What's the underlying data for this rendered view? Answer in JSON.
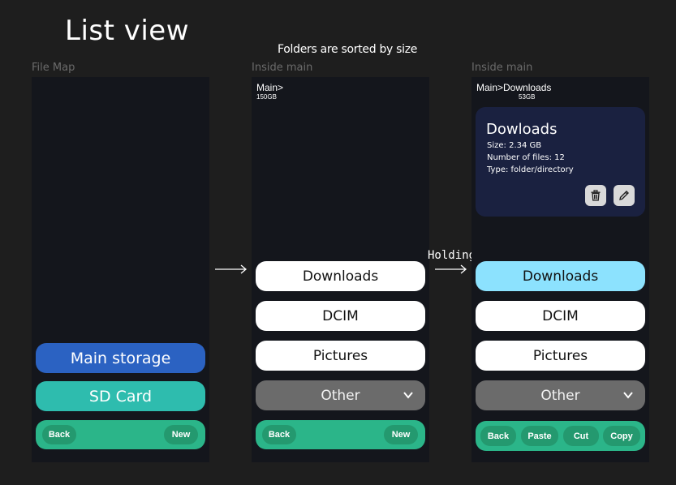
{
  "heading": {
    "title": "List view",
    "subtitle": "Folders are sorted by size"
  },
  "frames": [
    {
      "label": "File Map",
      "items": [
        {
          "label": "Main storage",
          "color": "#2b62c2"
        },
        {
          "label": "SD Card",
          "color": "#2ebcae"
        }
      ],
      "bar": {
        "back": "Back",
        "new": "New"
      }
    },
    {
      "label": "Inside main",
      "breadcrumb": "Main>",
      "size": "150GB",
      "items": [
        "Downloads",
        "DCIM",
        "Pictures"
      ],
      "dropdown": "Other",
      "bar": {
        "back": "Back",
        "new": "New"
      }
    },
    {
      "label": "Inside main",
      "breadcrumb": "Main>Downloads",
      "size": "53GB",
      "card": {
        "title": "Dowloads",
        "size_line": "Size: 2.34 GB",
        "files_line": "Number of files: 12",
        "type_line": "Type: folder/directory",
        "delete_icon": "trash-icon",
        "edit_icon": "pencil-icon"
      },
      "items": [
        "Downloads",
        "DCIM",
        "Pictures"
      ],
      "selected_color": "#8ce2fe",
      "dropdown": "Other",
      "bar": {
        "back": "Back",
        "paste": "Paste",
        "cut": "Cut",
        "copy": "Copy"
      }
    }
  ],
  "transition": {
    "holding": "Holding"
  },
  "colors": {
    "background": "#1e1e1e",
    "frame": "#14161c",
    "bar": "#2bb589",
    "card": "#1a2140"
  }
}
